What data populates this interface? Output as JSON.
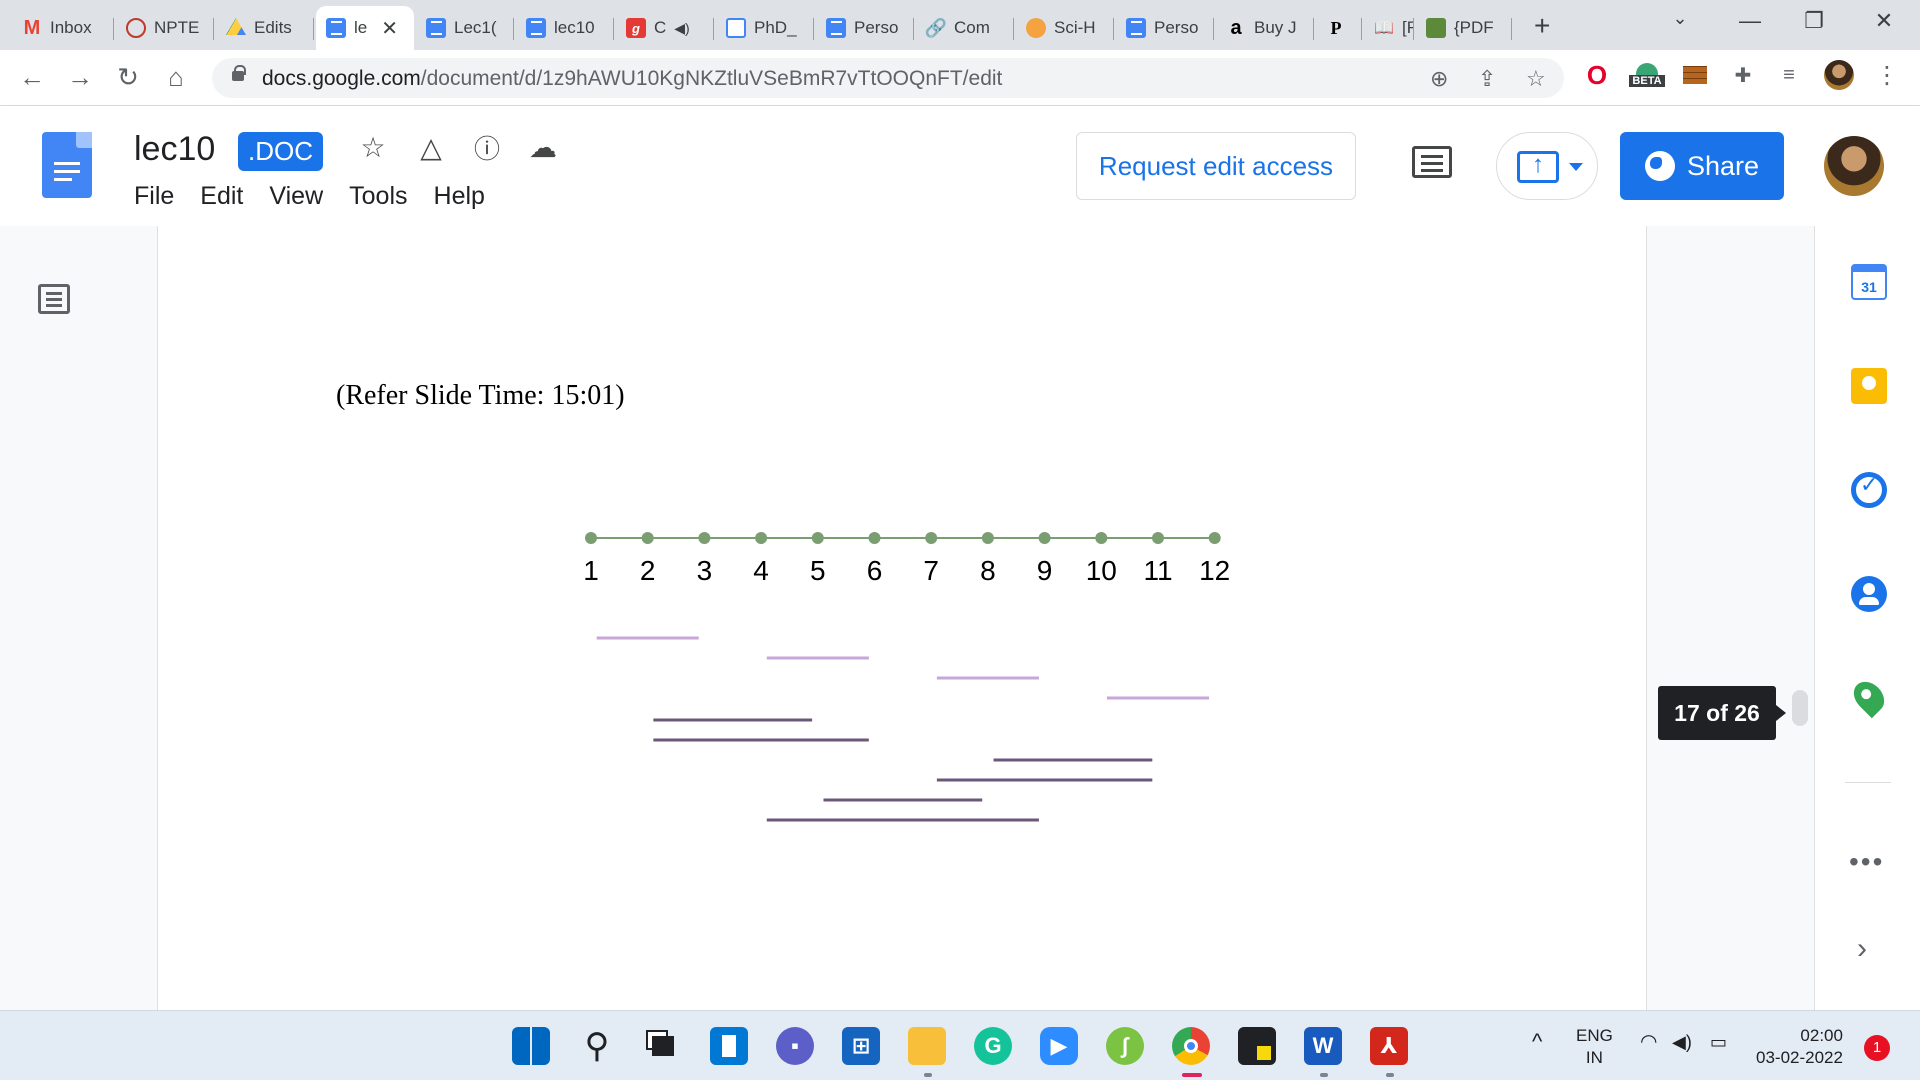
{
  "browser": {
    "tabs": [
      {
        "label": "Inbox",
        "icon": "gmail-icon"
      },
      {
        "label": "NPTE",
        "icon": "nptel-icon"
      },
      {
        "label": "Edits",
        "icon": "drive-icon"
      },
      {
        "label": "le",
        "icon": "docs-icon",
        "active": true
      },
      {
        "label": "Lec1(",
        "icon": "docs-icon"
      },
      {
        "label": "lec10",
        "icon": "docs-icon"
      },
      {
        "label": "C",
        "icon": "grammarly-icon"
      },
      {
        "label": "PhD_",
        "icon": "file-icon"
      },
      {
        "label": "Perso",
        "icon": "docs-icon"
      },
      {
        "label": "Com",
        "icon": "link-icon"
      },
      {
        "label": "Sci-H",
        "icon": "scihub-icon"
      },
      {
        "label": "Perso",
        "icon": "docs-icon"
      },
      {
        "label": "Buy J",
        "icon": "amazon-icon"
      },
      {
        "label": "",
        "icon": "p-icon"
      },
      {
        "label": "[F",
        "icon": "book-icon"
      },
      {
        "label": "{PDF",
        "icon": "pdf-site-icon"
      }
    ],
    "url_domain": "docs.google.com",
    "url_path": "/document/d/1z9hAWU10KgNKZtluVSeBmR7vTtOOQnFT/edit",
    "beta_label": "BETA"
  },
  "docs": {
    "title": "lec10",
    "badge": ".DOC",
    "menu": [
      "File",
      "Edit",
      "View",
      "Tools",
      "Help"
    ],
    "request_edit": "Request edit access",
    "share": "Share",
    "colors": {
      "accent": "#1a73e8",
      "dot": "#7a9e72",
      "light_line": "#c9a6d8",
      "dark_line": "#6b5779"
    }
  },
  "document": {
    "caption": "(Refer Slide Time: 15:01)",
    "timeline_labels": [
      "1",
      "2",
      "3",
      "4",
      "5",
      "6",
      "7",
      "8",
      "9",
      "10",
      "11",
      "12"
    ]
  },
  "page_indicator": "17 of 26",
  "side_panel": {
    "calendar_day": "31",
    "icons": [
      "calendar-icon",
      "keep-icon",
      "tasks-icon",
      "contacts-icon",
      "maps-icon"
    ]
  },
  "taskbar": {
    "apps": [
      "start-icon",
      "search-icon",
      "task-view-icon",
      "widgets-icon",
      "teams-chat-icon",
      "store-icon",
      "file-explorer-icon",
      "grammarly-icon",
      "zoom-icon",
      "evernote-icon",
      "chrome-icon",
      "sticky-notes-icon",
      "word-icon",
      "acrobat-icon"
    ],
    "lang_top": "ENG",
    "lang_bottom": "IN",
    "time": "02:00",
    "date": "03-02-2022",
    "notifications": "1"
  }
}
